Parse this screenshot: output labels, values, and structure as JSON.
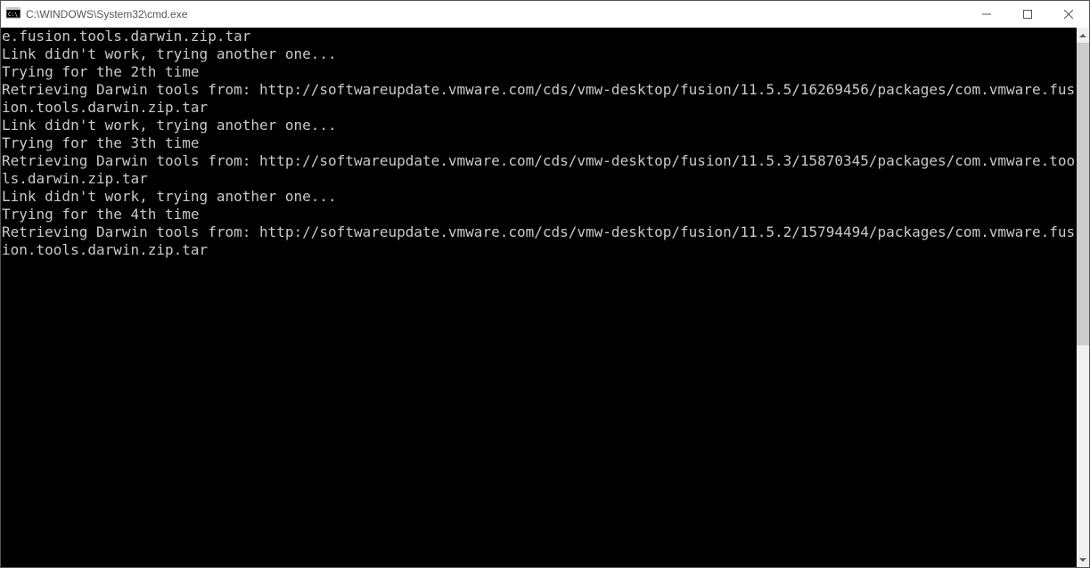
{
  "window": {
    "title": "C:\\WINDOWS\\System32\\cmd.exe"
  },
  "terminal": {
    "lines": [
      "e.fusion.tools.darwin.zip.tar",
      "Link didn't work, trying another one...",
      "Trying for the 2th time",
      "Retrieving Darwin tools from: http://softwareupdate.vmware.com/cds/vmw-desktop/fusion/11.5.5/16269456/packages/com.vmware.fusion.tools.darwin.zip.tar",
      "Link didn't work, trying another one...",
      "Trying for the 3th time",
      "Retrieving Darwin tools from: http://softwareupdate.vmware.com/cds/vmw-desktop/fusion/11.5.3/15870345/packages/com.vmware.tools.darwin.zip.tar",
      "Link didn't work, trying another one...",
      "Trying for the 4th time",
      "Retrieving Darwin tools from: http://softwareupdate.vmware.com/cds/vmw-desktop/fusion/11.5.2/15794494/packages/com.vmware.fusion.tools.darwin.zip.tar"
    ]
  }
}
